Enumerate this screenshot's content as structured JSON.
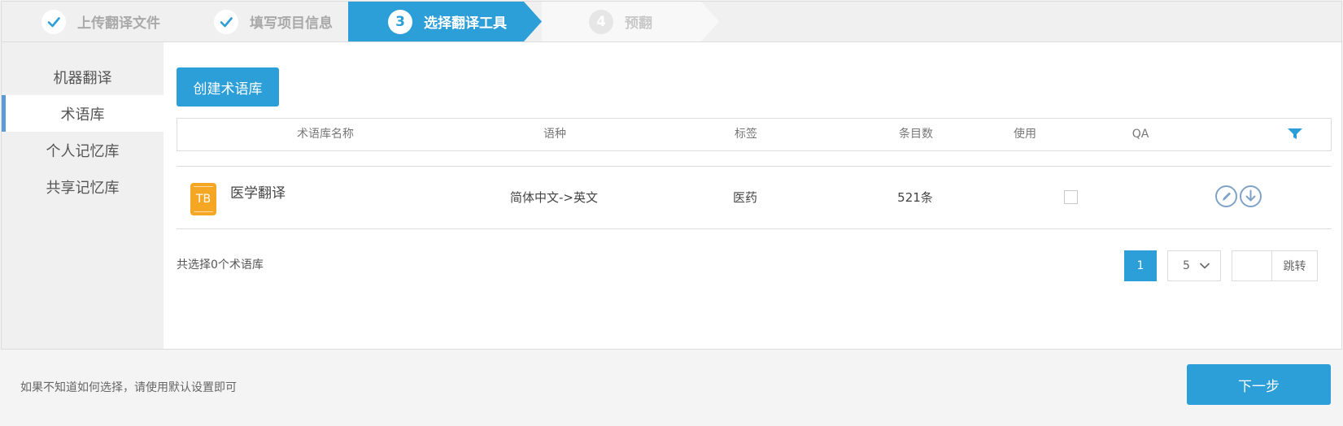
{
  "steps": [
    {
      "number": "",
      "label": "上传翻译文件",
      "state": "done"
    },
    {
      "number": "",
      "label": "填写项目信息",
      "state": "done"
    },
    {
      "number": "3",
      "label": "选择翻译工具",
      "state": "active"
    },
    {
      "number": "4",
      "label": "预翻",
      "state": "pending"
    }
  ],
  "sidebar": {
    "items": [
      {
        "label": "机器翻译"
      },
      {
        "label": "术语库"
      },
      {
        "label": "个人记忆库"
      },
      {
        "label": "共享记忆库"
      }
    ]
  },
  "main": {
    "create_button": "创建术语库",
    "columns": [
      "术语库名称",
      "语种",
      "标签",
      "条目数",
      "使用",
      "QA"
    ],
    "rows": [
      {
        "icon_text": "TB",
        "name": "医学翻译",
        "language": "简体中文->英文",
        "tag": "医药",
        "count": "521条",
        "used": false
      }
    ],
    "selected_text": "共选择0个术语库"
  },
  "pagination": {
    "current_page": "1",
    "page_size": "5",
    "jump_label": "跳转"
  },
  "footer": {
    "hint": "如果不知道如何选择，请使用默认设置即可",
    "next_button": "下一步"
  },
  "colors": {
    "accent": "#2c9ed8",
    "tb_icon": "#f5a623",
    "action_icon": "#7fa3c8"
  }
}
